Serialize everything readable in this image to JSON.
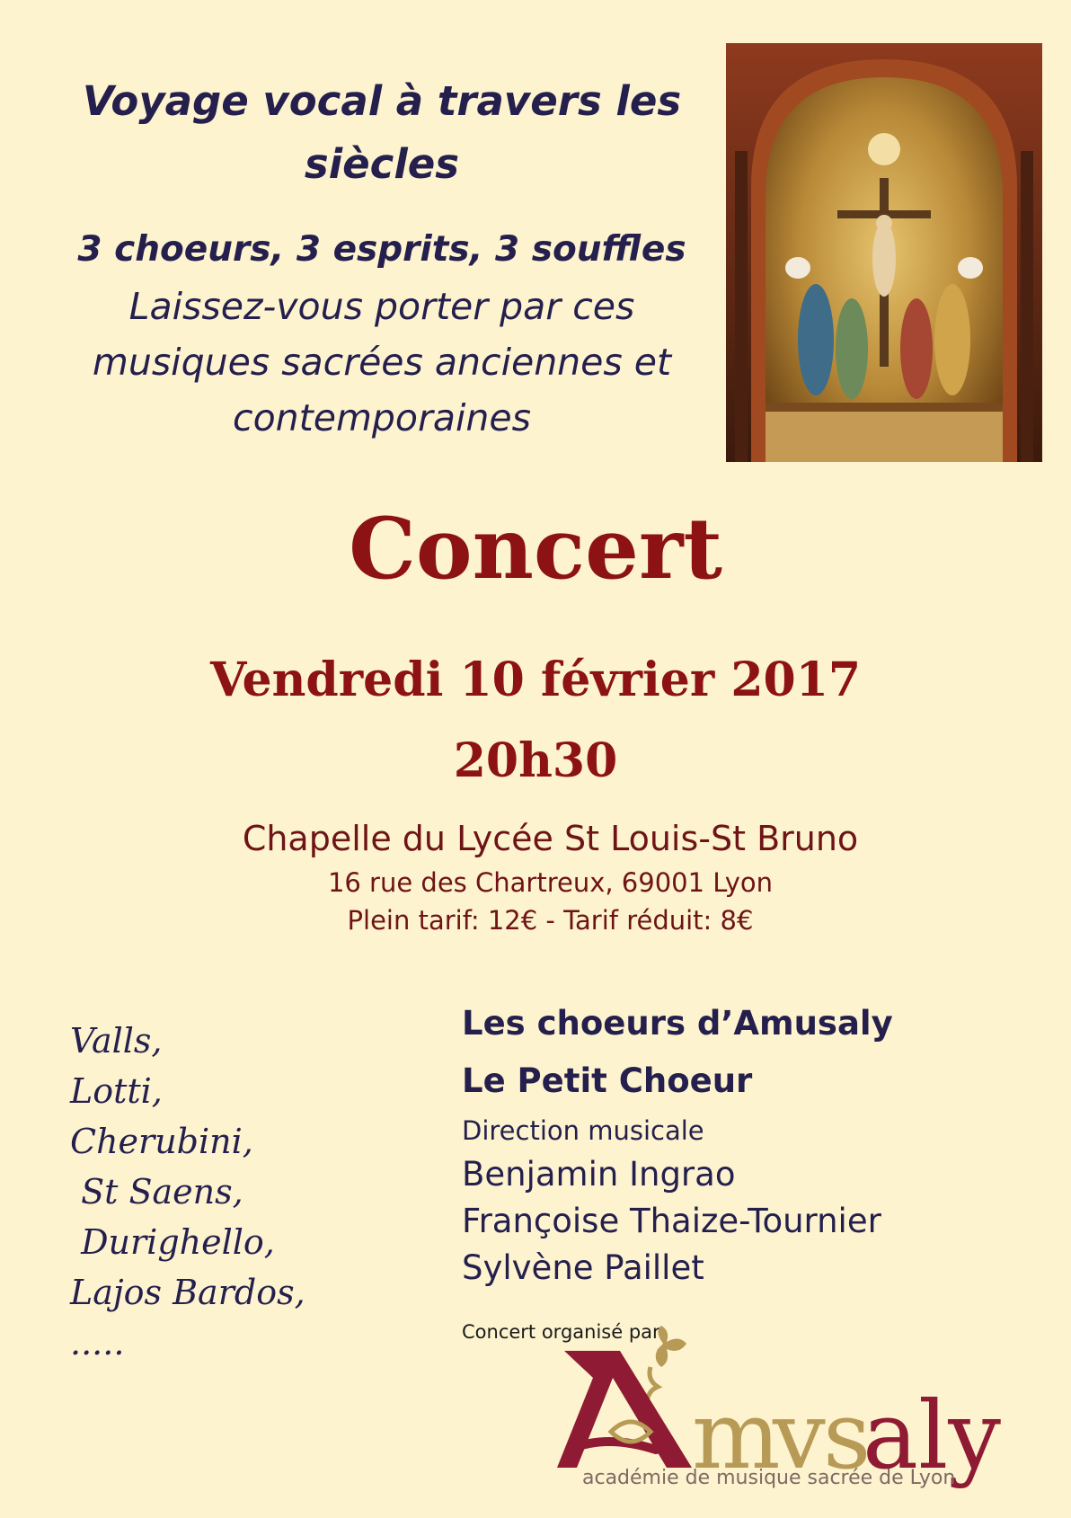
{
  "header": {
    "title": "Voyage vocal à travers les siècles",
    "subtitle": "3 choeurs, 3 esprits, 3 souffles",
    "tagline": "Laissez-vous porter par ces musiques sacrées  anciennes et contemporaines"
  },
  "event": {
    "heading": "Concert",
    "date": "Vendredi 10 février 2017",
    "time": "20h30",
    "venue": "Chapelle du Lycée St Louis-St Bruno",
    "address": "16 rue des Chartreux, 69001 Lyon",
    "prices": "Plein tarif: 12€ - Tarif réduit: 8€"
  },
  "composers": [
    "Valls,",
    "Lotti,",
    "Cherubini,",
    " St Saens,",
    " Durighello,",
    "Lajos Bardos,",
    "....."
  ],
  "choirs": [
    "Les choeurs d’Amusaly",
    "Le Petit Choeur"
  ],
  "direction": {
    "label": "Direction musicale",
    "names": [
      "Benjamin Ingrao",
      "Françoise Thaize-Tournier",
      "Sylvène Paillet"
    ]
  },
  "organizer": {
    "label": "Concert organisé par",
    "logo_text": "Amvsaly",
    "logo_tagline": "académie de musique sacrée de Lyon"
  },
  "colors": {
    "background": "#fdf3cf",
    "navy": "#241f4d",
    "crimson": "#8c1214",
    "logo_red": "#8f1a33",
    "logo_gold": "#b79a55"
  }
}
